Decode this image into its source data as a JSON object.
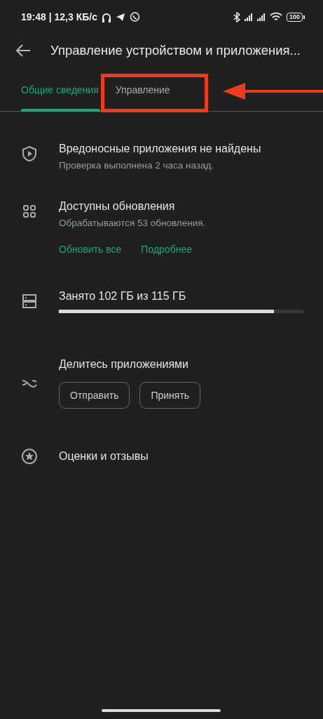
{
  "status_bar": {
    "time": "19:48 | 12,3 КБ/с",
    "battery": "100"
  },
  "app_bar": {
    "title": "Управление устройством и приложения..."
  },
  "tabs": [
    {
      "label": "Общие сведения",
      "selected": true,
      "highlighted": false
    },
    {
      "label": "Управление",
      "selected": false,
      "highlighted": true
    }
  ],
  "items": [
    {
      "kind": "status",
      "title": "Вредоносные приложения не найдены",
      "subtitle": "Проверка выполнена 2 часа назад."
    },
    {
      "kind": "updates",
      "title": "Доступны обновления",
      "subtitle": "Обрабатываются 53 обновления.",
      "actions": [
        "Обновить все",
        "Подробнее"
      ]
    },
    {
      "kind": "storage",
      "title": "Занято 102 ГБ из 115 ГБ",
      "level": 0.88
    },
    {
      "kind": "share",
      "title": "Делитесь приложениями",
      "buttons": [
        "Отправить",
        "Принять"
      ]
    },
    {
      "kind": "ratings",
      "title": "Оценки и отзывы"
    }
  ]
}
